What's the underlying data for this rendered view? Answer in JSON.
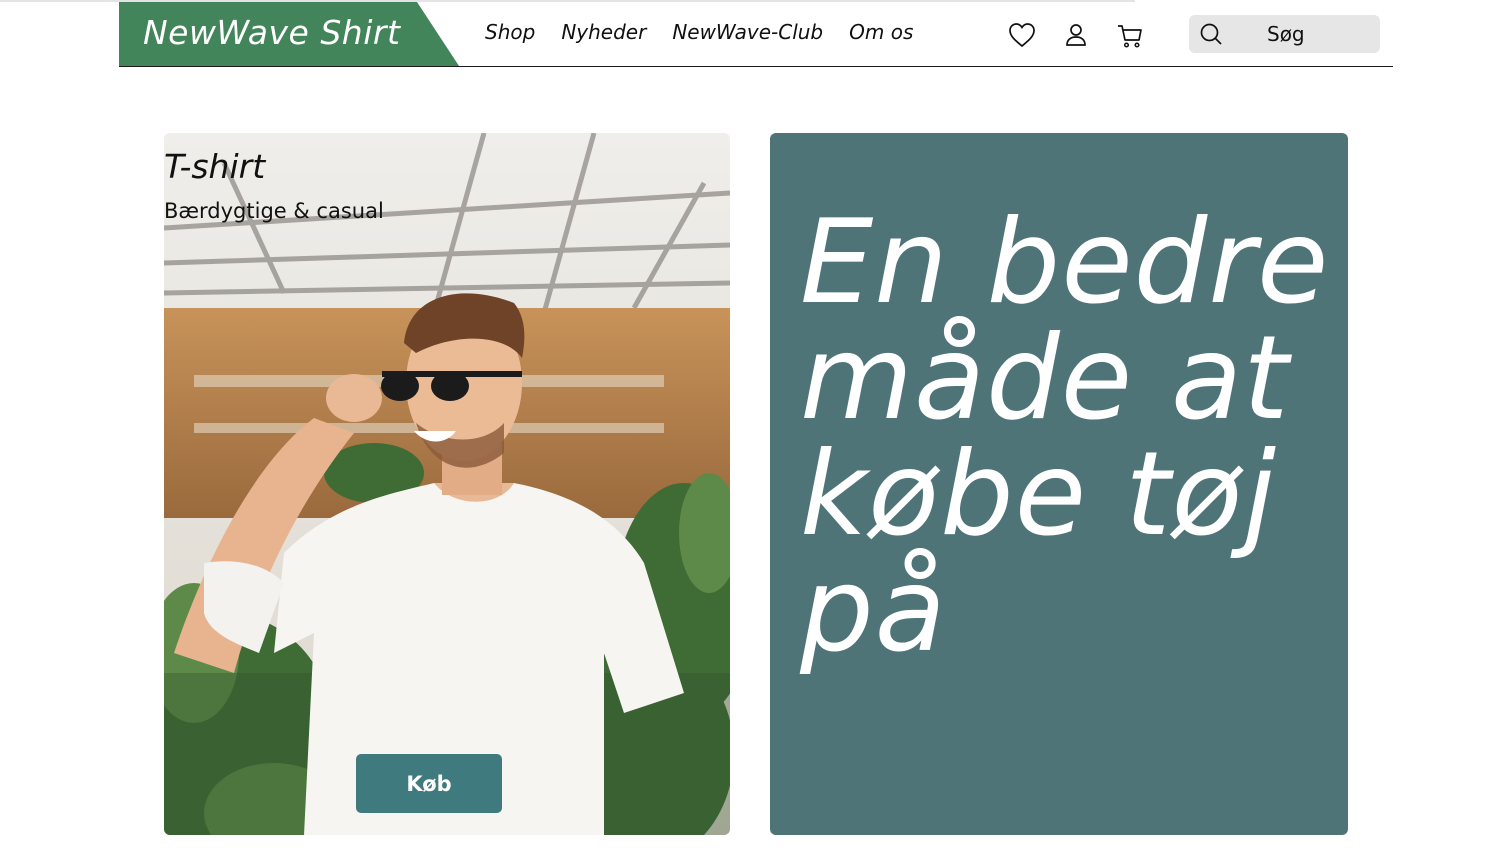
{
  "header": {
    "logo": "NewWave Shirt",
    "brand_color": "#43855a",
    "nav": [
      "Shop",
      "Nyheder",
      "NewWave-Club",
      "Om os"
    ],
    "icons": [
      "heart-icon",
      "user-icon",
      "cart-icon"
    ],
    "search": {
      "label": "Søg",
      "icon": "search-icon"
    }
  },
  "product_card": {
    "title": "T-shirt",
    "subtitle": "Bærdygtige & casual",
    "buy_label": "Køb",
    "button_color": "#3e7a7e"
  },
  "hero": {
    "text": "En bedre måde at købe tøj på",
    "background_color": "#4f7478"
  }
}
